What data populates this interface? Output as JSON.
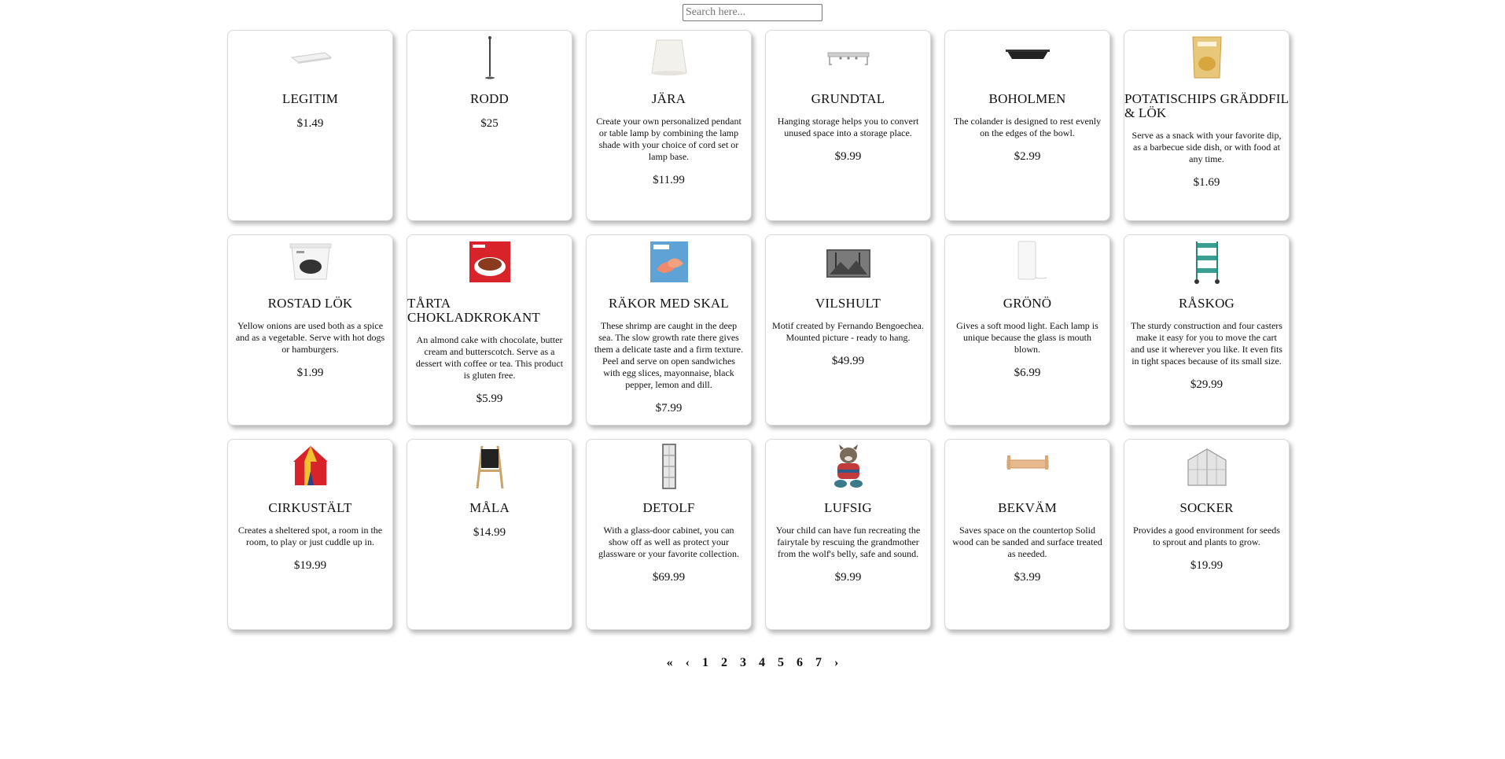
{
  "search": {
    "placeholder": "Search here..."
  },
  "products": [
    {
      "name": "LEGITIM",
      "desc": "",
      "price": "$1.49",
      "icon": "cutting-board-icon"
    },
    {
      "name": "RODD",
      "desc": "",
      "price": "$25",
      "icon": "floor-lamp-icon"
    },
    {
      "name": "JÄRA",
      "desc": "Create your own personalized pendant or table lamp by combining the lamp shade with your choice of cord set or lamp base.",
      "price": "$11.99",
      "icon": "lamp-shade-icon"
    },
    {
      "name": "GRUNDTAL",
      "desc": "Hanging storage helps you to convert unused space into a storage place.",
      "price": "$9.99",
      "icon": "hook-rail-icon"
    },
    {
      "name": "BOHOLMEN",
      "desc": "The colander is designed to rest evenly on the edges of the bowl.",
      "price": "$2.99",
      "icon": "colander-icon"
    },
    {
      "name": "POTATISCHIPS GRÄDDFIL & LÖK",
      "desc": "Serve as a snack with your favorite dip, as a barbecue side dish, or with food at any time.",
      "price": "$1.69",
      "icon": "chips-bag-icon"
    },
    {
      "name": "ROSTAD LÖK",
      "desc": "Yellow onions are used both as a spice and as a vegetable. Serve with hot dogs or hamburgers.",
      "price": "$1.99",
      "icon": "onion-tub-icon"
    },
    {
      "name": "TÅRTA CHOKLADKROKANT",
      "desc": "An almond cake with chocolate, butter cream and butterscotch. Serve as a dessert with coffee or tea. This product is gluten free.",
      "price": "$5.99",
      "icon": "cake-box-icon"
    },
    {
      "name": "RÄKOR MED SKAL",
      "desc": "These shrimp are caught in the deep sea. The slow growth rate there gives them a delicate taste and a firm texture. Peel and serve on open sandwiches with egg slices, mayonnaise, black pepper, lemon and dill.",
      "price": "$7.99",
      "icon": "shrimp-bag-icon"
    },
    {
      "name": "VILSHULT",
      "desc": "Motif created by Fernando Bengoechea. Mounted picture - ready to hang.",
      "price": "$49.99",
      "icon": "picture-icon"
    },
    {
      "name": "GRÖNÖ",
      "desc": "Gives a soft mood light. Each lamp is unique because the glass is mouth blown.",
      "price": "$6.99",
      "icon": "table-lamp-icon"
    },
    {
      "name": "RÅSKOG",
      "desc": "The sturdy construction and four casters make it easy for you to move the cart and use it wherever you like. It even fits in tight spaces because of its small size.",
      "price": "$29.99",
      "icon": "utility-cart-icon"
    },
    {
      "name": "CIRKUSTÄLT",
      "desc": "Creates a sheltered spot, a room in the room, to play or just cuddle up in.",
      "price": "$19.99",
      "icon": "circus-tent-icon"
    },
    {
      "name": "MÅLA",
      "desc": "",
      "price": "$14.99",
      "icon": "easel-icon"
    },
    {
      "name": "DETOLF",
      "desc": "With a glass-door cabinet, you can show off as well as protect your glassware or your favorite collection.",
      "price": "$69.99",
      "icon": "glass-cabinet-icon"
    },
    {
      "name": "LUFSIG",
      "desc": "Your child can have fun recreating the fairytale by rescuing the grandmother from the wolf's belly, safe and sound.",
      "price": "$9.99",
      "icon": "wolf-toy-icon"
    },
    {
      "name": "BEKVÄM",
      "desc": "Saves space on the countertop Solid wood can be sanded and surface treated as needed.",
      "price": "$3.99",
      "icon": "spice-rack-icon"
    },
    {
      "name": "SOCKER",
      "desc": "Provides a good environment for seeds to sprout and plants to grow.",
      "price": "$19.99",
      "icon": "greenhouse-icon"
    }
  ],
  "pagination": {
    "first": "«",
    "prev": "‹",
    "pages": [
      "1",
      "2",
      "3",
      "4",
      "5",
      "6",
      "7"
    ],
    "next": "›"
  }
}
